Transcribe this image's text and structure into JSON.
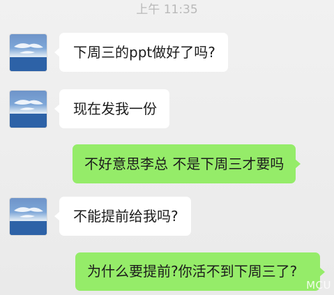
{
  "chat": {
    "timestamp": "上午 11:35",
    "messages": [
      {
        "sender": "other",
        "text": "下周三的ppt做好了吗?"
      },
      {
        "sender": "other",
        "text": "现在发我一份"
      },
      {
        "sender": "me",
        "text": "不好意思李总 不是下周三才要吗"
      },
      {
        "sender": "other",
        "text": "不能提前给我吗?"
      },
      {
        "sender": "me",
        "text": "为什么要提前?你活不到下周三了?"
      }
    ]
  },
  "watermark": "MCU",
  "colors": {
    "background": "#ececec",
    "incoming_bubble": "#ffffff",
    "outgoing_bubble": "#95ec69",
    "timestamp_text": "#b9b9b9"
  },
  "icons": {
    "avatar": "sky-sea-landscape-avatar"
  }
}
